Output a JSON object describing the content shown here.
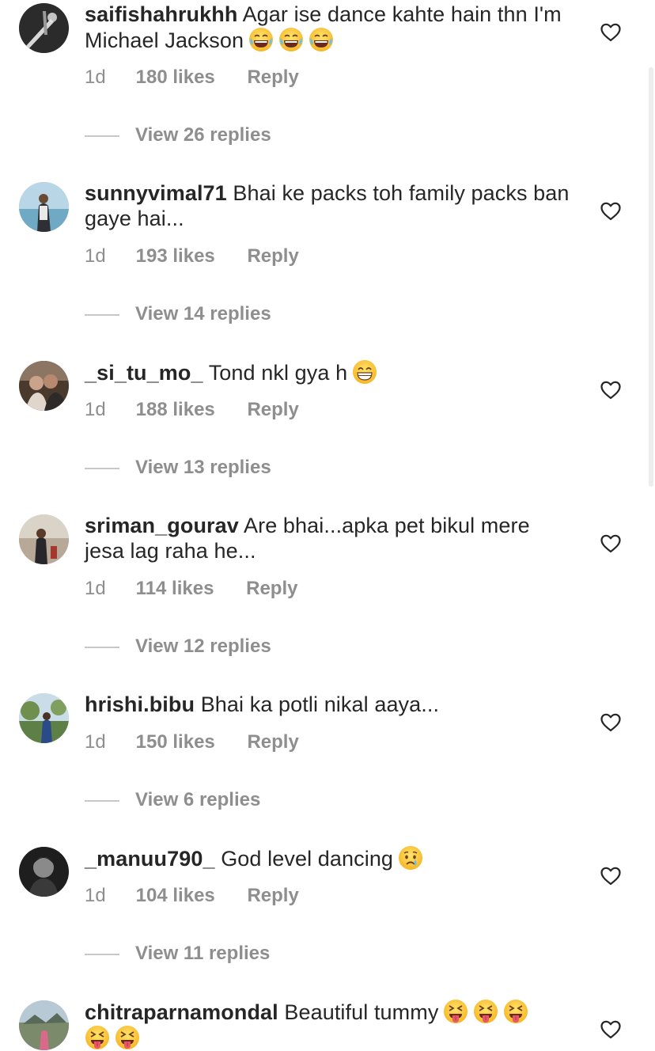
{
  "comments": [
    {
      "username": "saifishahrukhh",
      "text": "Agar ise dance kahte hain thn I'm Michael Jackson",
      "emojis": [
        "laughing-tears-emoji",
        "laughing-tears-emoji",
        "laughing-tears-emoji"
      ],
      "time": "1d",
      "likes": "180 likes",
      "reply": "Reply",
      "view_replies": "View 26 replies"
    },
    {
      "username": "sunnyvimal71",
      "text": "Bhai ke packs toh family packs ban gaye hai...",
      "emojis": [],
      "time": "1d",
      "likes": "193 likes",
      "reply": "Reply",
      "view_replies": "View 14 replies"
    },
    {
      "username": "_si_tu_mo_",
      "text": "Tond nkl gya h",
      "emojis": [
        "grinning-face-emoji"
      ],
      "time": "1d",
      "likes": "188 likes",
      "reply": "Reply",
      "view_replies": "View 13 replies"
    },
    {
      "username": "sriman_gourav",
      "text": "Are bhai...apka pet bikul mere jesa lag raha he...",
      "emojis": [],
      "time": "1d",
      "likes": "114 likes",
      "reply": "Reply",
      "view_replies": "View 12 replies"
    },
    {
      "username": "hrishi.bibu",
      "text": "Bhai ka potli nikal aaya...",
      "emojis": [],
      "time": "1d",
      "likes": "150 likes",
      "reply": "Reply",
      "view_replies": "View 6 replies"
    },
    {
      "username": "_manuu790_",
      "text": "God level dancing",
      "emojis": [
        "crying-face-emoji"
      ],
      "time": "1d",
      "likes": "104 likes",
      "reply": "Reply",
      "view_replies": "View 11 replies"
    },
    {
      "username": "chitraparnamondal",
      "text": "Beautiful tummy",
      "emojis": [
        "squinting-tongue-emoji",
        "squinting-tongue-emoji",
        "squinting-tongue-emoji",
        "squinting-tongue-emoji",
        "squinting-tongue-emoji"
      ],
      "time": "",
      "likes": "",
      "reply": "",
      "view_replies": ""
    }
  ],
  "icons": {
    "like": "heart-outline-icon"
  },
  "colors": {
    "text": "#262626",
    "secondary": "#8e8e8e",
    "divider": "#c7c7c7"
  }
}
